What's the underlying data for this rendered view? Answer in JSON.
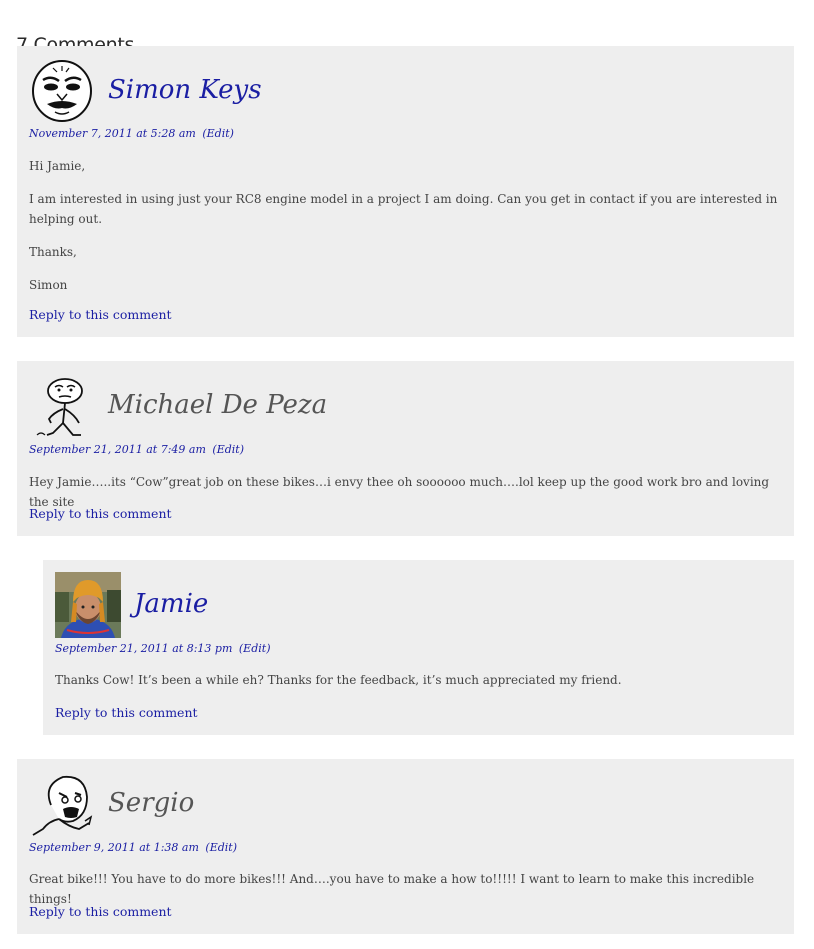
{
  "heading": "7 Comments",
  "comments": [
    {
      "author": "Simon Keys",
      "date": "November 7, 2011 at 5:28 am",
      "edit": "(Edit)",
      "paragraphs": [
        "Hi Jamie,",
        "I am interested in using just your RC8 engine model in a project I am doing. Can you get in contact if you are interested in helping out.",
        "Thanks,",
        "Simon"
      ],
      "reply": "Reply to this comment",
      "avatar_icon": "rage-face-me-gusta"
    },
    {
      "author": "Michael De Peza",
      "date": "September 21, 2011 at 7:49 am",
      "edit": "(Edit)",
      "paragraphs": [
        "Hey Jamie…..its “Cow”great job on these bikes…i envy thee oh soooooo much….lol keep up the good work bro and loving the site"
      ],
      "reply": "Reply to this comment",
      "avatar_icon": "rage-face-thinking"
    },
    {
      "author": "Jamie",
      "date": "September 21, 2011 at 8:13 pm",
      "edit": "(Edit)",
      "paragraphs": [
        "Thanks Cow! It’s been a while eh? Thanks for the feedback, it’s much appreciated my friend."
      ],
      "reply": "Reply to this comment",
      "avatar_icon": "user-photo"
    },
    {
      "author": "Sergio",
      "date": "September 9, 2011 at 1:38 am",
      "edit": "(Edit)",
      "paragraphs": [
        "Great bike!!! You have to do more bikes!!! And….you have to make a how to!!!!! I want to learn to make this incredible things!"
      ],
      "reply": "Reply to this comment",
      "avatar_icon": "rage-face-y-u-no"
    }
  ],
  "colors": {
    "link": "#1a1ea3",
    "card_bg": "#eeeeee",
    "text": "#444444"
  }
}
